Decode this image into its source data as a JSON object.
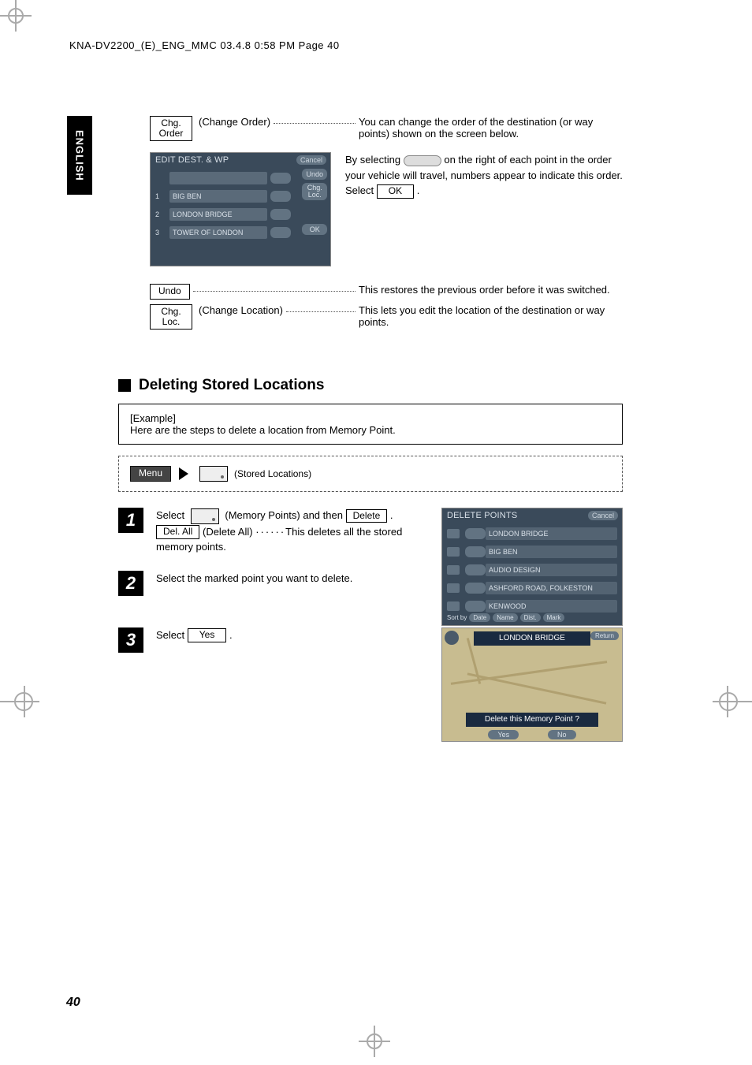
{
  "header_line": "KNA-DV2200_(E)_ENG_MMC  03.4.8  0:58 PM  Page 40",
  "side_tab": "ENGLISH",
  "top": {
    "chg_order_btn_l1": "Chg.",
    "chg_order_btn_l2": "Order",
    "chg_order_label": "(Change Order)",
    "chg_order_desc": "You can change the order of the destination (or way points) shown on the screen below.",
    "shot1": {
      "title": "EDIT DEST. & WP",
      "cancel": "Cancel",
      "undo": "Undo",
      "items": [
        {
          "label": "",
          "badge": ""
        },
        {
          "label": "BIG BEN",
          "badge": "1"
        },
        {
          "label": "LONDON BRIDGE",
          "badge": "2"
        },
        {
          "label": "TOWER OF LONDON",
          "badge": "3"
        }
      ],
      "chg_loc_l1": "Chg.",
      "chg_loc_l2": "Loc.",
      "ok": "OK"
    },
    "selecting_pre": "By selecting",
    "selecting_post": "on the right of each point in the order your vehicle will travel, numbers appear to indicate this order.",
    "select_word": "Select",
    "ok_btn": "OK",
    "period": ".",
    "undo_btn": "Undo",
    "undo_desc": "This restores the previous order before it was switched.",
    "chg_loc_l1": "Chg.",
    "chg_loc_l2": "Loc.",
    "chg_loc_label": "(Change Location)",
    "chg_loc_desc": "This lets you edit the location of the destination or way points."
  },
  "section_title": "Deleting Stored Locations",
  "example": {
    "heading": "[Example]",
    "body": "Here are the steps to delete a location from Memory Point."
  },
  "nav": {
    "menu": "Menu",
    "stored_locations": "(Stored Locations)"
  },
  "steps": {
    "s1": {
      "num": "1",
      "t1": "Select",
      "mem_pts": "(Memory Points) and then",
      "delete_btn": "Delete",
      "delall_btn": "Del. All",
      "delall_label": "(Delete All)",
      "delall_desc": "This deletes all the stored memory points."
    },
    "s2": {
      "num": "2",
      "body": "Select the marked point you want to delete."
    },
    "s3": {
      "num": "3",
      "t1": "Select",
      "yes_btn": "Yes",
      "period": "."
    }
  },
  "shot2": {
    "title": "DELETE POINTS",
    "cancel": "Cancel",
    "items": [
      "LONDON BRIDGE",
      "BIG BEN",
      "AUDIO DESIGN",
      "ASHFORD ROAD, FOLKESTON",
      "KENWOOD"
    ],
    "sort_label": "Sort by",
    "sort_buttons": [
      "Date",
      "Name",
      "Dist.",
      "Mark"
    ]
  },
  "mapshot": {
    "banner": "LONDON BRIDGE",
    "return": "Return",
    "confirm": "Delete this Memory Point ?",
    "yes": "Yes",
    "no": "No"
  },
  "page_number": "40"
}
